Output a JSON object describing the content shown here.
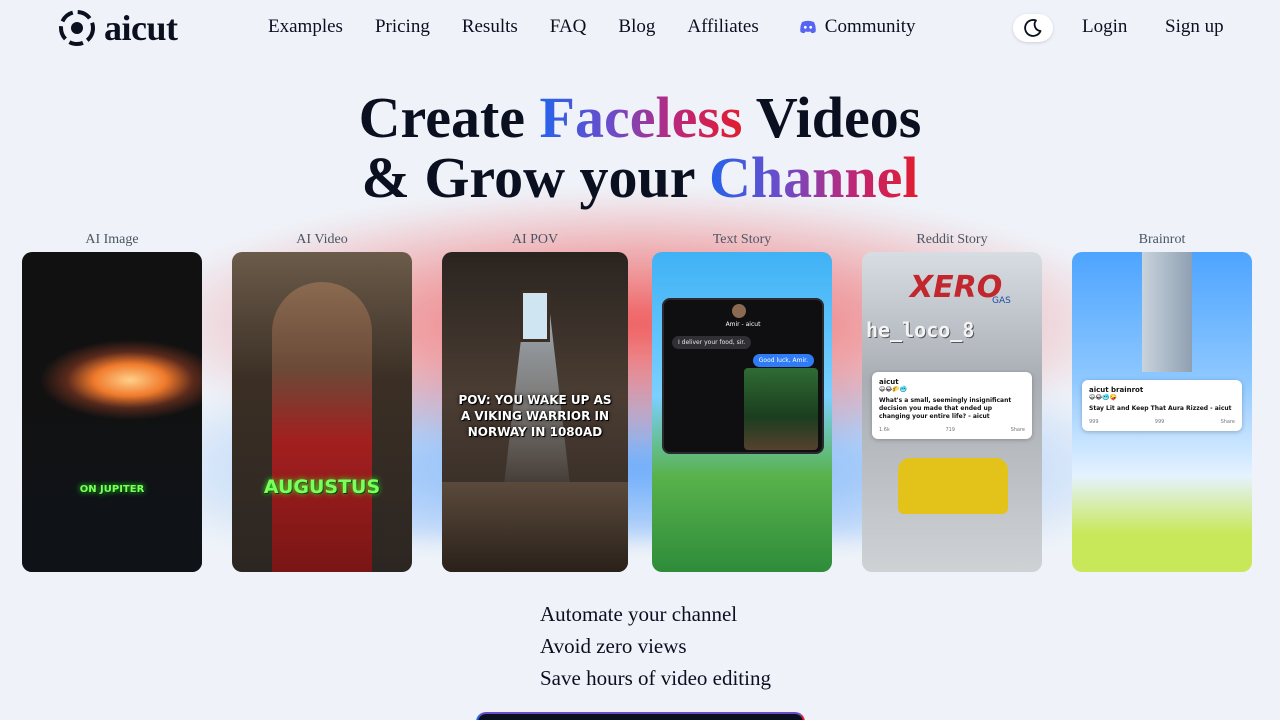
{
  "brand": {
    "name": "aicut"
  },
  "nav": {
    "items": [
      "Examples",
      "Pricing",
      "Results",
      "FAQ",
      "Blog",
      "Affiliates"
    ],
    "community": "Community"
  },
  "auth": {
    "login": "Login",
    "signup": "Sign up"
  },
  "hero": {
    "line1_a": "Create ",
    "line1_b": "Faceless",
    "line1_c": " Videos",
    "line2_a": "& Grow your ",
    "line2_b": "Channel"
  },
  "cards": [
    {
      "label": "AI Image",
      "caption": "ON JUPITER"
    },
    {
      "label": "AI Video",
      "caption": "AUGUSTUS"
    },
    {
      "label": "AI POV",
      "caption": "POV: YOU WAKE UP AS A VIKING WARRIOR IN NORWAY IN 1080AD"
    },
    {
      "label": "Text Story",
      "contact": "Amir - aicut",
      "msg_in": "I deliver your food, sir.",
      "msg_out": "Good luck, Amir."
    },
    {
      "label": "Reddit Story",
      "banner": "XERO",
      "banner_sub": "GAS",
      "username": "he_loco_8",
      "post_name": "aicut",
      "post_emojis": "😃😂🌮🥶",
      "post_body": "What's a small, seemingly insignificant decision you made that ended up changing your entire life? - aicut",
      "likes": "1.6k",
      "comments": "719",
      "share": "Share"
    },
    {
      "label": "Brainrot",
      "post_name": "aicut brainrot",
      "post_emojis": "😃😂🥶🤪",
      "post_body": "Stay Lit and Keep That Aura Rizzed - aicut",
      "likes": "999",
      "comments": "999",
      "share": "Share"
    }
  ],
  "features": [
    "Automate your channel",
    "Avoid zero views",
    "Save hours of video editing"
  ],
  "colors": {
    "gradient_start": "#2563eb",
    "gradient_mid": "#6d4cc9",
    "gradient_end": "#e11d2e",
    "discord": "#5865f2"
  }
}
